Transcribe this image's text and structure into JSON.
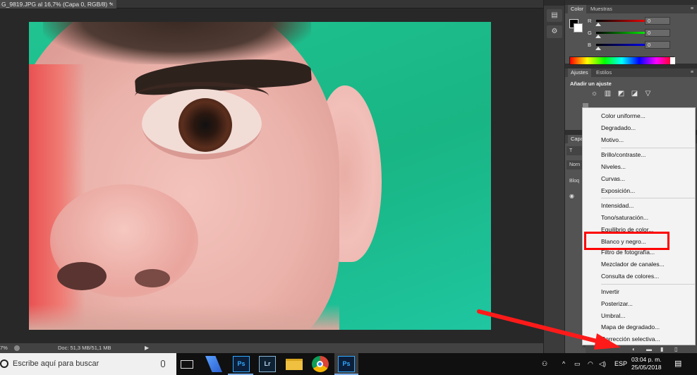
{
  "document": {
    "tab_title": "G_9819.JPG al 16,7% (Capa 0, RGB/8) *",
    "close_glyph": "×"
  },
  "status_bar": {
    "zoom": "7%",
    "doc_info": "Doc: 51,3 MB/51,1 MB",
    "arrow": "▶"
  },
  "color_panel": {
    "tabs": [
      "Color",
      "Muestras"
    ],
    "rows": [
      {
        "label": "R",
        "value": "0",
        "color": "#e01010"
      },
      {
        "label": "G",
        "value": "0",
        "color": "#10b010"
      },
      {
        "label": "B",
        "value": "0",
        "color": "#1010d0"
      }
    ]
  },
  "adjustments_panel": {
    "tabs": [
      "Ajustes",
      "Estilos"
    ],
    "title": "Añadir un ajuste"
  },
  "layers_panel": {
    "tab": "Capa",
    "filter": "T",
    "blend": "Norn",
    "lock": "Bloq"
  },
  "adjustment_menu": {
    "groups": [
      [
        "Color uniforme...",
        "Degradado...",
        "Motivo..."
      ],
      [
        "Brillo/contraste...",
        "Niveles...",
        "Curvas...",
        "Exposición..."
      ],
      [
        "Intensidad...",
        "Tono/saturación...",
        "Equilibrio de color...",
        "Blanco y negro...",
        "Filtro de fotografía...",
        "Mezclador de canales...",
        "Consulta de colores..."
      ],
      [
        "Invertir",
        "Posterizar...",
        "Umbral...",
        "Mapa de degradado...",
        "Corrección selectiva..."
      ]
    ],
    "highlighted_item": "Blanco y negro..."
  },
  "taskbar": {
    "search_placeholder": "Escribe aquí para buscar",
    "apps": [
      {
        "name": "task-view",
        "label": ""
      },
      {
        "name": "visual-studio",
        "label": ""
      },
      {
        "name": "photoshop",
        "label": "Ps"
      },
      {
        "name": "lightroom",
        "label": "Lr"
      },
      {
        "name": "file-explorer",
        "label": ""
      },
      {
        "name": "chrome",
        "label": ""
      },
      {
        "name": "photoshop-active",
        "label": "Ps"
      }
    ],
    "language": "ESP",
    "time": "03:04 p. m.",
    "date": "25/05/2018"
  },
  "colors": {
    "accent_red": "#ff0000",
    "ps_blue": "#31a8ff",
    "panel_bg": "#535353",
    "menu_bg": "#f3f3f3"
  }
}
